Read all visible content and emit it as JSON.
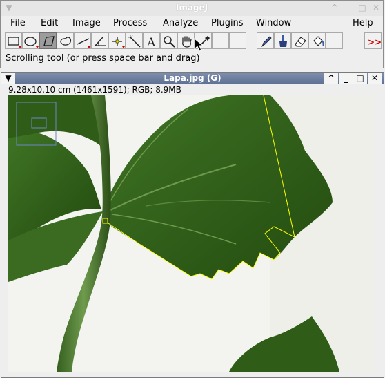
{
  "main_window": {
    "title": "ImageJ",
    "menus": [
      "File",
      "Edit",
      "Image",
      "Process",
      "Analyze",
      "Plugins",
      "Window",
      "Help"
    ],
    "tools": [
      {
        "name": "rectangle-tool-icon"
      },
      {
        "name": "oval-tool-icon"
      },
      {
        "name": "polygon-tool-icon",
        "selected": true
      },
      {
        "name": "freehand-tool-icon"
      },
      {
        "name": "line-tool-icon"
      },
      {
        "name": "angle-tool-icon"
      },
      {
        "name": "point-tool-icon"
      },
      {
        "name": "wand-tool-icon"
      },
      {
        "name": "text-tool-icon"
      },
      {
        "name": "magnifier-tool-icon"
      },
      {
        "name": "hand-scroll-tool-icon"
      },
      {
        "name": "color-picker-tool-icon"
      },
      {
        "name": "empty-tool-slot"
      },
      {
        "name": "empty-tool-slot"
      },
      {
        "name": "pencil-tool-icon"
      },
      {
        "name": "brush-tool-icon"
      },
      {
        "name": "eraser-tool-icon"
      },
      {
        "name": "flood-fill-tool-icon"
      },
      {
        "name": "empty-tool-slot"
      },
      {
        "name": "more-tools-icon"
      }
    ],
    "text_tool_glyph": "A",
    "more_tools_glyph": ">>",
    "status": "Scrolling tool (or press space bar and drag)"
  },
  "image_window": {
    "title": "Lapa.jpg (G)",
    "info": "9.28x10.10 cm (1461x1591); RGB; 8.9MB"
  },
  "colors": {
    "selection_roi": "#ffff00",
    "leaf_dark": "#2d5a14",
    "leaf_light": "#4a7f2a",
    "background_paper": "#f3f3ef",
    "image_titlebar": "#6a7ba0"
  }
}
